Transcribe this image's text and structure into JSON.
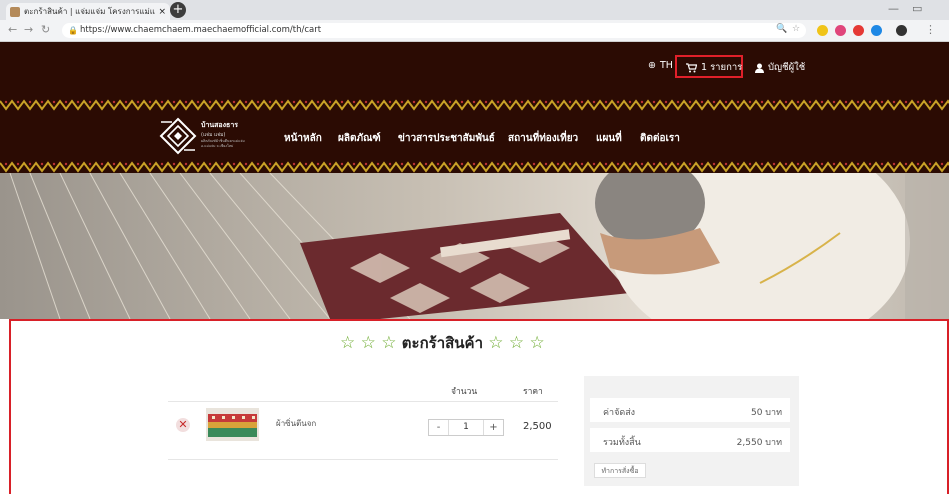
{
  "browser": {
    "tab_title": "ตะกร้าสินค้า | แจ่มแจ่ม โครงการแม่แจ่ม",
    "tab_close": "×",
    "new_tab": "+",
    "url": "https://www.chaemchaem.maechaemofficial.com/th/cart",
    "window_min": "—",
    "window_max": "▭"
  },
  "topbar": {
    "language": "TH",
    "cart_label": "1 รายการ",
    "account_label": "บัญชีผู้ใช้"
  },
  "logo": {
    "name": "บ้านสองธาร",
    "sub": "(แจ่ม แจ่ม)",
    "tagline_1": "ผลิตภัณฑ์ผ้าซิ่นตีนจกแม่แจ่ม",
    "tagline_2": "อ.แม่แจ่ม จ.เชียงใหม่"
  },
  "nav": {
    "items": [
      "หน้าหลัก",
      "ผลิตภัณฑ์",
      "ข่าวสารประชาสัมพันธ์",
      "สถานที่ท่องเที่ยว",
      "แผนที่",
      "ติดต่อเรา"
    ]
  },
  "cart": {
    "title": "ตะกร้าสินค้า",
    "col_quantity": "จำนวน",
    "col_price": "ราคา",
    "item": {
      "name": "ผ้าซิ่นตีนจก",
      "quantity": "1",
      "price": "2,500"
    },
    "summary": {
      "shipping_label": "ค่าจัดส่ง",
      "shipping_value": "50 บาท",
      "total_label": "รวมทั้งสิ้น",
      "total_value": "2,550 บาท",
      "checkout_label": "ทำการสั่งซื้อ"
    }
  },
  "colors": {
    "header_bg": "#2b0b03",
    "pattern_gold": "#c9a227",
    "highlight_red": "#d82028",
    "star_green": "#6cab2e"
  }
}
